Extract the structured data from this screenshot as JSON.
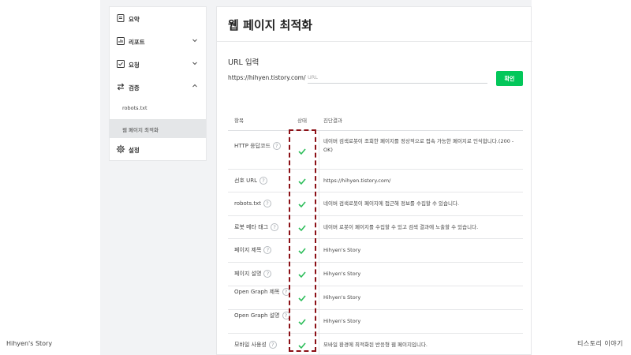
{
  "sidebar": {
    "items": [
      {
        "label": "요약",
        "icon": "summary-icon"
      },
      {
        "label": "리포트",
        "icon": "report-icon",
        "expandable": true
      },
      {
        "label": "요청",
        "icon": "request-icon",
        "expandable": true
      },
      {
        "label": "검증",
        "icon": "verify-icon",
        "expanded": true
      }
    ],
    "subitems": [
      {
        "label": "robots.txt"
      },
      {
        "label": "웹 페이지 최적화",
        "active": true
      }
    ],
    "settings": {
      "label": "설정",
      "icon": "gear-icon"
    }
  },
  "main": {
    "title": "웹 페이지 최적화",
    "url_label": "URL 입력",
    "url_prefix": "https://hihyen.tistory.com/",
    "url_placeholder": "URL",
    "confirm_label": "확인",
    "columns": [
      "항목",
      "상태",
      "진단결과"
    ],
    "rows": [
      {
        "name": "HTTP 응답코드",
        "status": "ok",
        "result": "네이버 검색로봇이 조회한 페이지를 정상적으로 접속 가능한 페이지로 인식합니다.(200 - OK)"
      },
      {
        "name": "선호 URL",
        "status": "ok",
        "result": "https://hihyen.tistory.com/"
      },
      {
        "name": "robots.txt",
        "status": "ok",
        "result": "네이버 검색로봇이 페이지에 접근해 정보를 수집할 수 있습니다."
      },
      {
        "name": "로봇 메타 태그",
        "status": "ok",
        "result": "네이버 로봇이 페이지를 수집할 수 있고 검색 결과에 노출할 수 있습니다."
      },
      {
        "name": "페이지 제목",
        "status": "ok",
        "result": "Hihyen's Story"
      },
      {
        "name": "페이지 설명",
        "status": "ok",
        "result": "Hihyen's Story"
      },
      {
        "name": "Open Graph 제목",
        "status": "ok",
        "result": "Hihyen's Story"
      },
      {
        "name": "Open Graph 설명",
        "status": "ok",
        "result": "Hihyen's Story"
      },
      {
        "name": "모바일 사용성",
        "status": "ok",
        "result": "모바일 환경에 최적화된 반응형 웹 페이지입니다."
      }
    ]
  },
  "footer": {
    "left": "Hihyen's Story",
    "right": "티스토리 이야기"
  },
  "colors": {
    "accent_green": "#03c75a",
    "highlight_red": "#8b0f15",
    "check_green": "#2dbd5a"
  }
}
